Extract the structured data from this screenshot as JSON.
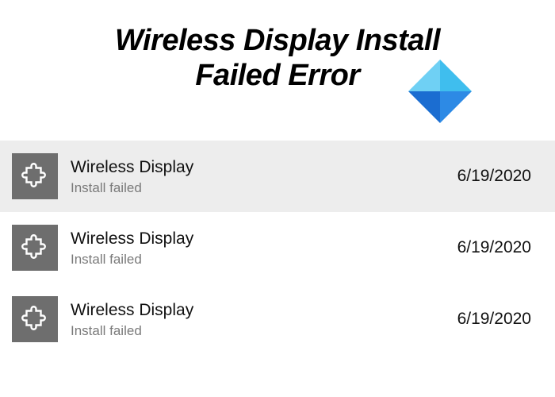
{
  "header": {
    "title_line1": "Wireless Display Install",
    "title_line2": "Failed Error"
  },
  "colors": {
    "icon_bg": "#6e6e6e",
    "logo_light": "#3fbeee",
    "logo_dark": "#1b6dd1",
    "selected_bg": "#ededed"
  },
  "items": [
    {
      "title": "Wireless Display",
      "status": "Install failed",
      "date": "6/19/2020",
      "selected": true
    },
    {
      "title": "Wireless Display",
      "status": "Install failed",
      "date": "6/19/2020",
      "selected": false
    },
    {
      "title": "Wireless Display",
      "status": "Install failed",
      "date": "6/19/2020",
      "selected": false
    }
  ]
}
